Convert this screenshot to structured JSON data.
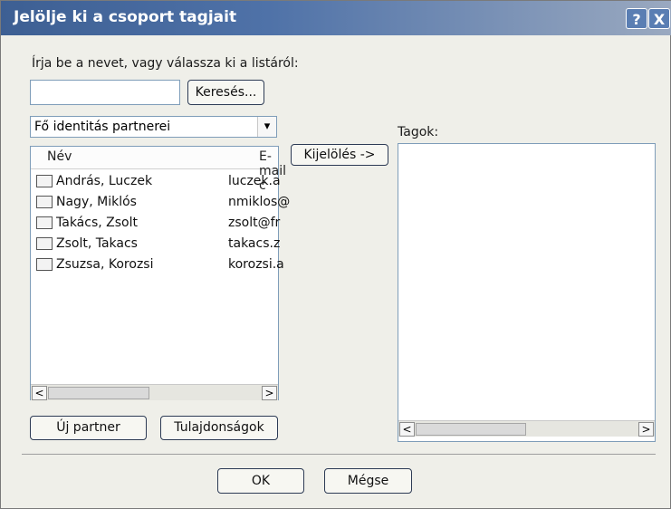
{
  "window": {
    "title": "Jelölje ki a csoport tagjait",
    "help_glyph": "?",
    "close_glyph": "X"
  },
  "left": {
    "prompt": "Írja be a nevet, vagy válassza ki a listáról:",
    "search_value": "",
    "search_button": "Keresés...",
    "dropdown_value": "Fő identitás partnerei",
    "columns": [
      "Név",
      "E-mail c"
    ],
    "contacts": [
      {
        "name": "András, Luczek",
        "email": "luczek.a"
      },
      {
        "name": "Nagy, Miklós",
        "email": "nmiklos@"
      },
      {
        "name": "Takács, Zsolt",
        "email": "zsolt@fr"
      },
      {
        "name": "Zsolt, Takacs",
        "email": "takacs.z"
      },
      {
        "name": "Zsuzsa, Korozsi",
        "email": "korozsi.a"
      }
    ],
    "new_partner_button": "Új partner",
    "properties_button": "Tulajdonságok"
  },
  "middle": {
    "select_button": "Kijelölés ->"
  },
  "right": {
    "members_label": "Tagok:"
  },
  "footer": {
    "ok_button": "OK",
    "cancel_button": "Mégse"
  }
}
